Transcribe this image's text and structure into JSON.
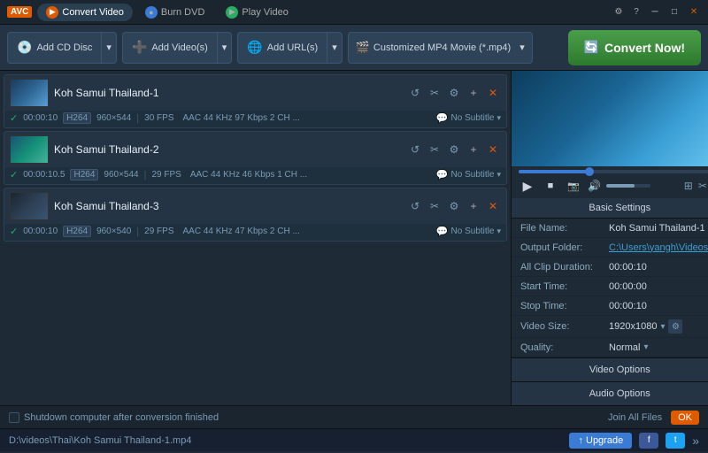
{
  "titlebar": {
    "logo": "AVC",
    "nav_items": [
      {
        "label": "Convert Video",
        "active": true,
        "icon_color": "orange"
      },
      {
        "label": "Burn DVD",
        "active": false,
        "icon_color": "blue"
      },
      {
        "label": "Play Video",
        "active": false,
        "icon_color": "green"
      }
    ],
    "controls": [
      "⚙",
      "?",
      "–",
      "□",
      "✕"
    ]
  },
  "toolbar": {
    "add_cd_label": "Add CD Disc",
    "add_video_label": "Add Video(s)",
    "add_url_label": "Add URL(s)",
    "format_label": "Customized MP4 Movie (*.mp4)",
    "convert_label": "Convert Now!"
  },
  "files": [
    {
      "name": "Koh Samui Thailand-1",
      "duration": "00:00:10",
      "resolution": "960×544",
      "fps": "30 FPS",
      "audio": "AAC 44 KHz 97 Kbps 2 CH ...",
      "subtitle": "No Subtitle",
      "thumb_style": "blue"
    },
    {
      "name": "Koh Samui Thailand-2",
      "duration": "00:00:10.5",
      "resolution": "960×544",
      "fps": "29 FPS",
      "audio": "AAC 44 KHz 46 Kbps 1 CH ...",
      "subtitle": "No Subtitle",
      "thumb_style": "green"
    },
    {
      "name": "Koh Samui Thailand-3",
      "duration": "00:00:10",
      "resolution": "960×540",
      "fps": "29 FPS",
      "audio": "AAC 44 KHz 47 Kbps 2 CH ...",
      "subtitle": "No Subtitle",
      "thumb_style": "dark"
    }
  ],
  "settings": {
    "title": "Basic Settings",
    "file_name_label": "File Name:",
    "file_name_value": "Koh Samui Thailand-1",
    "output_folder_label": "Output Folder:",
    "output_folder_value": "C:\\Users\\yangh\\Videos\\...",
    "all_clip_duration_label": "All Clip Duration:",
    "all_clip_duration_value": "00:00:10",
    "start_time_label": "Start Time:",
    "start_time_value": "00:00:00",
    "stop_time_label": "Stop Time:",
    "stop_time_value": "00:00:10",
    "video_size_label": "Video Size:",
    "video_size_value": "1920x1080",
    "quality_label": "Quality:",
    "quality_value": "Normal",
    "video_options_label": "Video Options",
    "audio_options_label": "Audio Options"
  },
  "status_bar": {
    "checkbox_label": "Shutdown computer after conversion finished",
    "join_label": "Join All Files",
    "ok_label": "OK"
  },
  "bottom_bar": {
    "file_path": "D:\\videos\\Thai\\Koh Samui Thailand-1.mp4",
    "upgrade_label": "↑ Upgrade",
    "fb_label": "f",
    "tw_label": "t",
    "forward_label": "»"
  }
}
